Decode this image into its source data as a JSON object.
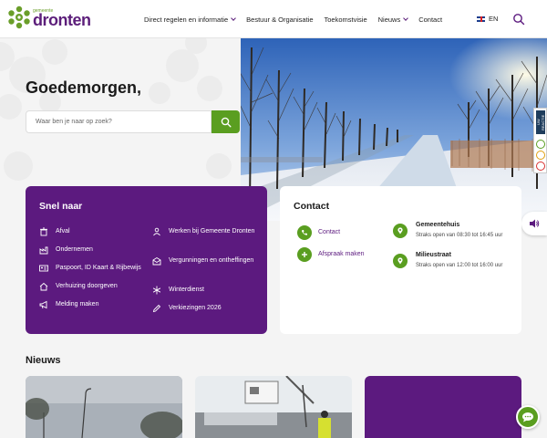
{
  "header": {
    "logo_small": "gemeente",
    "logo_word": "dronten",
    "nav": [
      {
        "label": "Direct regelen en informatie",
        "dropdown": true
      },
      {
        "label": "Bestuur & Organisatie",
        "dropdown": false
      },
      {
        "label": "Toekomstvisie",
        "dropdown": false
      },
      {
        "label": "Nieuws",
        "dropdown": true
      },
      {
        "label": "Contact",
        "dropdown": false
      }
    ],
    "language": "EN"
  },
  "hero": {
    "greeting": "Goedemorgen,",
    "search_placeholder": "Waar ben je naar op zoek?"
  },
  "side": {
    "reactie_label": "UW REACTIE"
  },
  "snel_naar": {
    "title": "Snel naar",
    "left": [
      {
        "label": "Afval",
        "icon": "trash-icon"
      },
      {
        "label": "Ondernemen",
        "icon": "factory-icon"
      },
      {
        "label": "Paspoort, ID Kaart & Rijbewijs",
        "icon": "id-card-icon"
      },
      {
        "label": "Verhuizing doorgeven",
        "icon": "house-icon"
      },
      {
        "label": "Melding maken",
        "icon": "megaphone-icon"
      }
    ],
    "right": [
      {
        "label": "Werken bij Gemeente Dronten",
        "icon": "person-icon"
      },
      {
        "label": "Vergunningen en ontheffingen",
        "icon": "envelope-icon"
      },
      {
        "label": "Winterdienst",
        "icon": "snowflake-icon"
      },
      {
        "label": "Verkiezingen 2026",
        "icon": "pencil-icon"
      }
    ]
  },
  "contact": {
    "title": "Contact",
    "links": [
      {
        "label": "Contact",
        "icon": "phone-icon"
      },
      {
        "label": "Afspraak maken",
        "icon": "plus-icon"
      }
    ],
    "locations": [
      {
        "name": "Gemeentehuis",
        "hours": "Straks open van 08:30 tot 16:45 uur"
      },
      {
        "name": "Milieustraat",
        "hours": "Straks open van 12:00 tot 16:00 uur"
      }
    ]
  },
  "nieuws": {
    "title": "Nieuws"
  },
  "colors": {
    "purple": "#5c1a7f",
    "green": "#5a9e20"
  }
}
